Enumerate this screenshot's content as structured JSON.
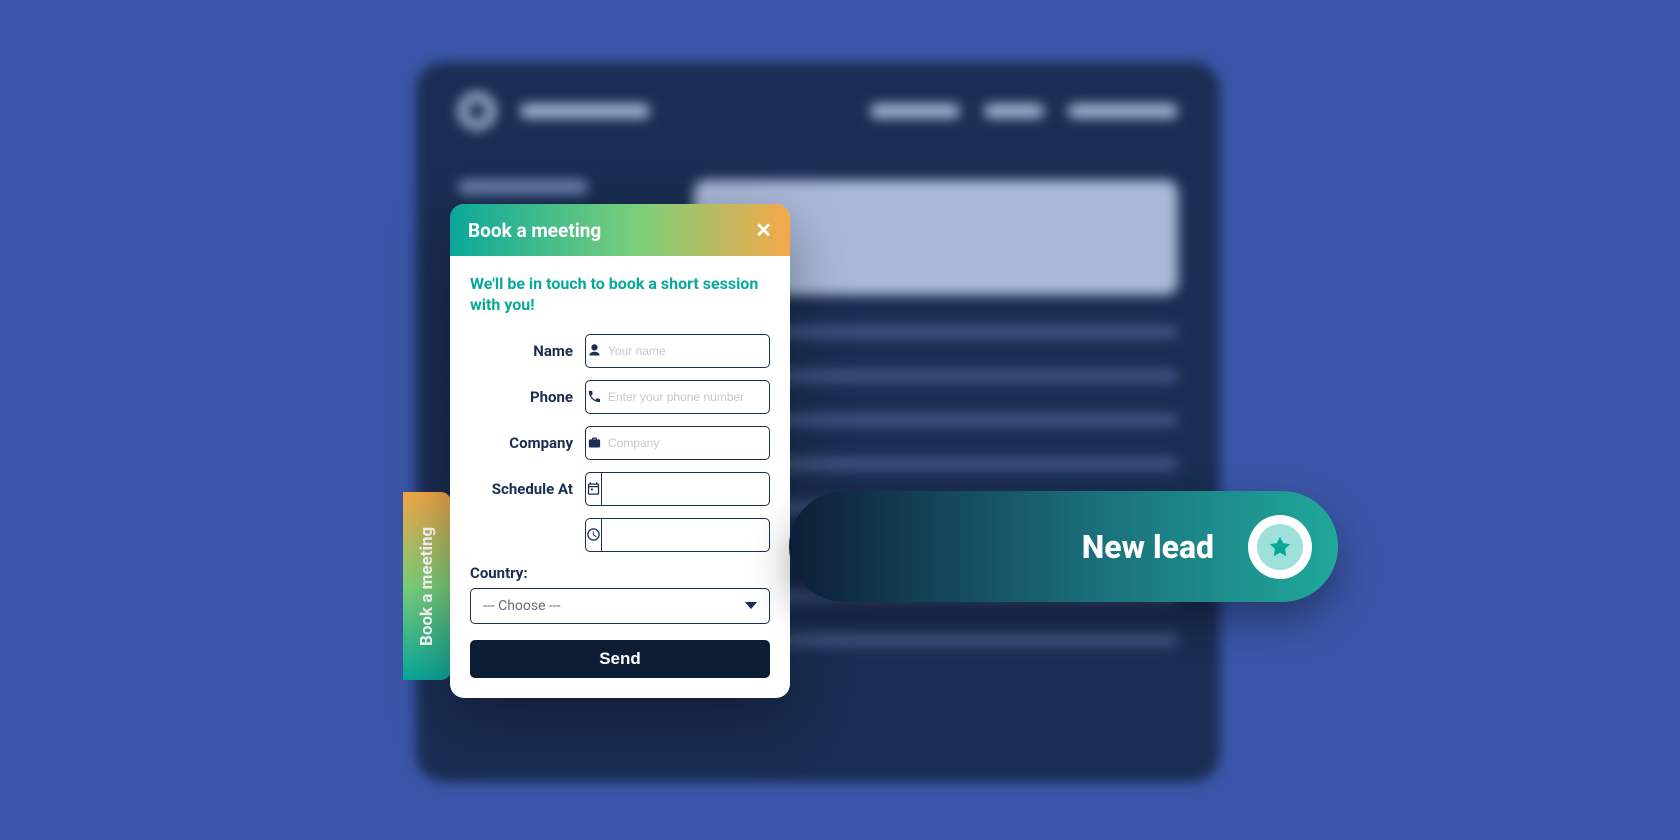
{
  "side_tab": {
    "label": "Book a meeting"
  },
  "modal": {
    "title": "Book a meeting",
    "subtitle": "We'll be in touch to book a short session with you!",
    "fields": {
      "name": {
        "label": "Name",
        "placeholder": "Your name"
      },
      "phone": {
        "label": "Phone",
        "placeholder": "Enter your phone number"
      },
      "company": {
        "label": "Company",
        "placeholder": "Company"
      },
      "schedule": {
        "label": "Schedule At"
      }
    },
    "country": {
      "label": "Country:",
      "selected": "--- Choose ---"
    },
    "send_label": "Send"
  },
  "lead_pill": {
    "label": "New lead"
  }
}
